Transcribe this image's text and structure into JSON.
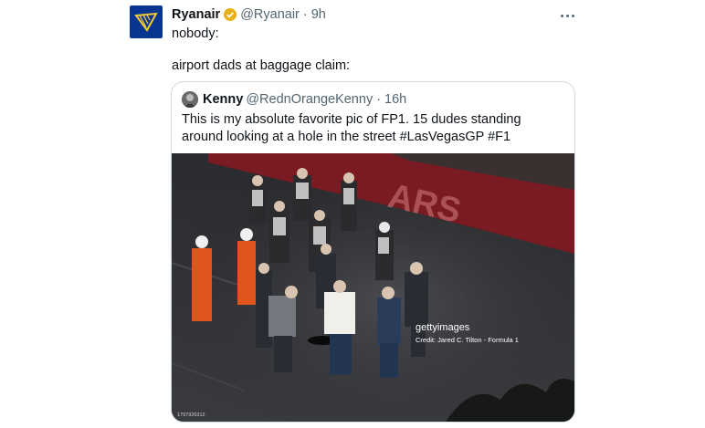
{
  "tweet": {
    "author_name": "Ryanair",
    "author_handle": "@Ryanair",
    "separator": "·",
    "time": "9h",
    "lines": [
      "nobody:",
      "airport dads at baggage claim:"
    ]
  },
  "quote": {
    "author_name": "Kenny",
    "author_handle": "@RednOrangeKenny",
    "separator": "·",
    "time": "16h",
    "text": "This is my absolute favorite pic of FP1.  15 dudes standing around looking at a hole in the street #LasVegasGP #F1"
  },
  "photo": {
    "watermark_brand": "gettyimages",
    "credit": "Credit: Jared C. Tilton - Formula 1",
    "image_id": "1797926312",
    "track_lettering": "ARS",
    "barrier_color": "#7a1a22"
  },
  "icons": {
    "verified": "verified-badge-icon",
    "more": "more-options-icon",
    "logo": "ryanair-harp-logo"
  },
  "colors": {
    "brand_blue": "#073590",
    "brand_yellow": "#f1c933",
    "secondary_text": "#536471"
  }
}
